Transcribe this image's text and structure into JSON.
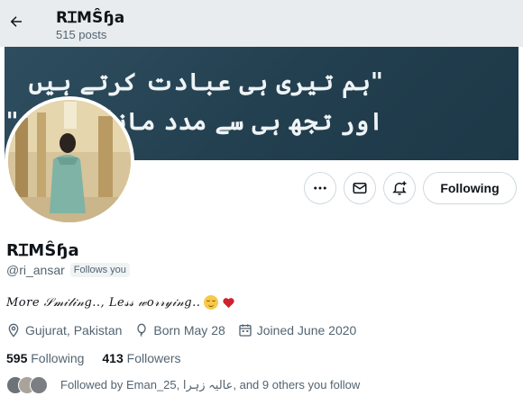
{
  "header": {
    "name": "RꞮMŜɧa",
    "posts": "515 posts"
  },
  "banner": {
    "line1": "\"ہم تیری ہی عبادت کرتے ہیں",
    "line2": "اور تجھ ہی سے مدد مانگتے ہیں\""
  },
  "actions": {
    "following_label": "Following"
  },
  "profile": {
    "display_name": "RꞮMŜɧa",
    "handle": "@ri_ansar",
    "follows_you": "Follows you",
    "bio": "𝑀𝑜𝑟𝑒 𝒮𝓂𝒾𝓁𝒾𝓃𝑔.., 𝐿𝑒𝓈𝓈 𝓌𝑜𝓇𝓇𝓎𝒾𝓃𝑔..",
    "location": "Gujurat, Pakistan",
    "born": "Born May 28",
    "joined": "Joined June 2020"
  },
  "stats": {
    "following_count": "595",
    "following_label": "Following",
    "followers_count": "413",
    "followers_label": "Followers"
  },
  "followed_by": {
    "text": "Followed by Eman_25, عالیہ زہرا, and 9 others you follow"
  },
  "icons": {
    "back": "back-arrow-icon",
    "more": "more-icon",
    "message": "mail-icon",
    "notify": "notification-bell-icon",
    "location": "location-pin-icon",
    "born": "balloon-icon",
    "joined": "calendar-icon"
  },
  "colors": {
    "banner": "#2e4e5f",
    "secondary_text": "#536471",
    "border": "#cfd9de"
  }
}
